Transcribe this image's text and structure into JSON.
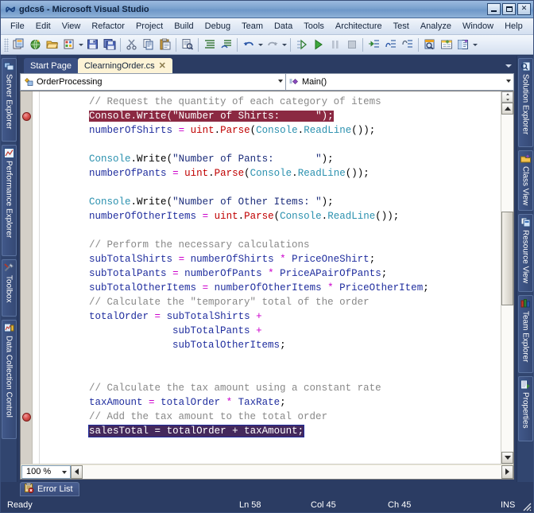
{
  "window": {
    "title": "gdcs6 - Microsoft Visual Studio",
    "app_icon": "visual-studio-icon",
    "minimize_label": "_",
    "maximize_label": "□",
    "close_label": "✕"
  },
  "menu": {
    "items": [
      {
        "label": "File"
      },
      {
        "label": "Edit"
      },
      {
        "label": "View"
      },
      {
        "label": "Refactor"
      },
      {
        "label": "Project"
      },
      {
        "label": "Build"
      },
      {
        "label": "Debug"
      },
      {
        "label": "Team"
      },
      {
        "label": "Data"
      },
      {
        "label": "Tools"
      },
      {
        "label": "Architecture"
      },
      {
        "label": "Test"
      },
      {
        "label": "Analyze"
      },
      {
        "label": "Window"
      },
      {
        "label": "Help"
      }
    ]
  },
  "toolbar": {
    "buttons": [
      {
        "name": "new-project-icon"
      },
      {
        "name": "add-new-website-icon"
      },
      {
        "name": "open-file-icon"
      },
      {
        "name": "add-new-item-icon"
      },
      {
        "name": "save-icon"
      },
      {
        "name": "save-all-icon"
      },
      {
        "name": "cut-icon"
      },
      {
        "name": "copy-icon"
      },
      {
        "name": "paste-icon"
      },
      {
        "name": "find-icon"
      },
      {
        "name": "comment-selection-icon"
      },
      {
        "name": "uncomment-selection-icon"
      },
      {
        "name": "undo-icon"
      },
      {
        "name": "redo-icon"
      },
      {
        "name": "start-debug-icon"
      },
      {
        "name": "continue-icon"
      },
      {
        "name": "break-all-icon"
      },
      {
        "name": "stop-debugging-icon"
      },
      {
        "name": "step-into-icon"
      },
      {
        "name": "step-over-icon"
      },
      {
        "name": "step-out-icon"
      },
      {
        "name": "solution-explorer-icon"
      },
      {
        "name": "properties-window-icon"
      },
      {
        "name": "object-browser-icon"
      },
      {
        "name": "toolbar-overflow-icon"
      }
    ]
  },
  "left_dock": {
    "tabs": [
      {
        "label": "Server Explorer",
        "icon": "server-explorer-icon"
      },
      {
        "label": "Performance Explorer",
        "icon": "performance-explorer-icon"
      },
      {
        "label": "Toolbox",
        "icon": "toolbox-icon"
      },
      {
        "label": "Data Collection Control",
        "icon": "data-collection-icon"
      }
    ]
  },
  "right_dock": {
    "tabs": [
      {
        "label": "Solution Explorer",
        "icon": "solution-explorer-icon"
      },
      {
        "label": "Class View",
        "icon": "class-view-icon"
      },
      {
        "label": "Resource View",
        "icon": "resource-view-icon"
      },
      {
        "label": "Team Explorer",
        "icon": "team-explorer-icon"
      },
      {
        "label": "Properties",
        "icon": "properties-icon"
      }
    ]
  },
  "document_tabs": {
    "tabs": [
      {
        "label": "Start Page",
        "active": false,
        "closable": false
      },
      {
        "label": "ClearningOrder.cs",
        "active": true,
        "closable": true,
        "close_label": "✕"
      }
    ],
    "overflow_menu": "tab-list-menu-icon"
  },
  "navigation_bar": {
    "class_combo": {
      "value": "OrderProcessing",
      "icon": "class-icon"
    },
    "member_combo": {
      "value": "Main()",
      "icon": "method-icon"
    }
  },
  "editor": {
    "zoom": "100 %",
    "breakpoints": [
      {
        "line_index": 1
      },
      {
        "line_index": 22
      }
    ],
    "lines": [
      {
        "indent": 8,
        "tokens": [
          {
            "t": "// Request the quantity of each category of items",
            "c": "cmt"
          }
        ]
      },
      {
        "indent": 8,
        "hl": "exec",
        "tokens": [
          {
            "t": "Console",
            "c": "typ"
          },
          {
            "t": ".",
            "c": "pun"
          },
          {
            "t": "Write",
            "c": "pun"
          },
          {
            "t": "(",
            "c": "pun"
          },
          {
            "t": "\"Number of Shirts:      \"",
            "c": "str"
          },
          {
            "t": ");",
            "c": "pun"
          }
        ]
      },
      {
        "indent": 8,
        "tokens": [
          {
            "t": "numberOfShirts",
            "c": "id"
          },
          {
            "t": " ",
            "c": "pun"
          },
          {
            "t": "=",
            "c": "op"
          },
          {
            "t": " ",
            "c": "pun"
          },
          {
            "t": "uint",
            "c": "red"
          },
          {
            "t": ".",
            "c": "pun"
          },
          {
            "t": "Parse",
            "c": "red"
          },
          {
            "t": "(",
            "c": "pun"
          },
          {
            "t": "Console",
            "c": "typ"
          },
          {
            "t": ".",
            "c": "pun"
          },
          {
            "t": "ReadLine",
            "c": "typ"
          },
          {
            "t": "());",
            "c": "pun"
          }
        ]
      },
      {
        "indent": 0,
        "tokens": []
      },
      {
        "indent": 8,
        "tokens": [
          {
            "t": "Console",
            "c": "typ"
          },
          {
            "t": ".",
            "c": "pun"
          },
          {
            "t": "Write",
            "c": "pun"
          },
          {
            "t": "(",
            "c": "pun"
          },
          {
            "t": "\"Number of Pants:       \"",
            "c": "str"
          },
          {
            "t": ");",
            "c": "pun"
          }
        ]
      },
      {
        "indent": 8,
        "tokens": [
          {
            "t": "numberOfPants",
            "c": "id"
          },
          {
            "t": " ",
            "c": "pun"
          },
          {
            "t": "=",
            "c": "op"
          },
          {
            "t": " ",
            "c": "pun"
          },
          {
            "t": "uint",
            "c": "red"
          },
          {
            "t": ".",
            "c": "pun"
          },
          {
            "t": "Parse",
            "c": "red"
          },
          {
            "t": "(",
            "c": "pun"
          },
          {
            "t": "Console",
            "c": "typ"
          },
          {
            "t": ".",
            "c": "pun"
          },
          {
            "t": "ReadLine",
            "c": "typ"
          },
          {
            "t": "());",
            "c": "pun"
          }
        ]
      },
      {
        "indent": 0,
        "tokens": []
      },
      {
        "indent": 8,
        "tokens": [
          {
            "t": "Console",
            "c": "typ"
          },
          {
            "t": ".",
            "c": "pun"
          },
          {
            "t": "Write",
            "c": "pun"
          },
          {
            "t": "(",
            "c": "pun"
          },
          {
            "t": "\"Number of Other Items: \"",
            "c": "str"
          },
          {
            "t": ");",
            "c": "pun"
          }
        ]
      },
      {
        "indent": 8,
        "tokens": [
          {
            "t": "numberOfOtherItems",
            "c": "id"
          },
          {
            "t": " ",
            "c": "pun"
          },
          {
            "t": "=",
            "c": "op"
          },
          {
            "t": " ",
            "c": "pun"
          },
          {
            "t": "uint",
            "c": "red"
          },
          {
            "t": ".",
            "c": "pun"
          },
          {
            "t": "Parse",
            "c": "red"
          },
          {
            "t": "(",
            "c": "pun"
          },
          {
            "t": "Console",
            "c": "typ"
          },
          {
            "t": ".",
            "c": "pun"
          },
          {
            "t": "ReadLine",
            "c": "typ"
          },
          {
            "t": "());",
            "c": "pun"
          }
        ]
      },
      {
        "indent": 0,
        "tokens": []
      },
      {
        "indent": 8,
        "tokens": [
          {
            "t": "// Perform the necessary calculations",
            "c": "cmt"
          }
        ]
      },
      {
        "indent": 8,
        "tokens": [
          {
            "t": "subTotalShirts",
            "c": "id"
          },
          {
            "t": " ",
            "c": "pun"
          },
          {
            "t": "=",
            "c": "op"
          },
          {
            "t": " ",
            "c": "pun"
          },
          {
            "t": "numberOfShirts",
            "c": "id"
          },
          {
            "t": " ",
            "c": "pun"
          },
          {
            "t": "*",
            "c": "op"
          },
          {
            "t": " ",
            "c": "pun"
          },
          {
            "t": "PriceOneShirt",
            "c": "id"
          },
          {
            "t": ";",
            "c": "pun"
          }
        ]
      },
      {
        "indent": 8,
        "tokens": [
          {
            "t": "subTotalPants",
            "c": "id"
          },
          {
            "t": " ",
            "c": "pun"
          },
          {
            "t": "=",
            "c": "op"
          },
          {
            "t": " ",
            "c": "pun"
          },
          {
            "t": "numberOfPants",
            "c": "id"
          },
          {
            "t": " ",
            "c": "pun"
          },
          {
            "t": "*",
            "c": "op"
          },
          {
            "t": " ",
            "c": "pun"
          },
          {
            "t": "PriceAPairOfPants",
            "c": "id"
          },
          {
            "t": ";",
            "c": "pun"
          }
        ]
      },
      {
        "indent": 8,
        "tokens": [
          {
            "t": "subTotalOtherItems",
            "c": "id"
          },
          {
            "t": " ",
            "c": "pun"
          },
          {
            "t": "=",
            "c": "op"
          },
          {
            "t": " ",
            "c": "pun"
          },
          {
            "t": "numberOfOtherItems",
            "c": "id"
          },
          {
            "t": " ",
            "c": "pun"
          },
          {
            "t": "*",
            "c": "op"
          },
          {
            "t": " ",
            "c": "pun"
          },
          {
            "t": "PriceOtherItem",
            "c": "id"
          },
          {
            "t": ";",
            "c": "pun"
          }
        ]
      },
      {
        "indent": 8,
        "tokens": [
          {
            "t": "// Calculate the \"temporary\" total of the order",
            "c": "cmt"
          }
        ]
      },
      {
        "indent": 8,
        "tokens": [
          {
            "t": "totalOrder",
            "c": "id"
          },
          {
            "t": " ",
            "c": "pun"
          },
          {
            "t": "=",
            "c": "op"
          },
          {
            "t": " ",
            "c": "pun"
          },
          {
            "t": "subTotalShirts",
            "c": "id"
          },
          {
            "t": " ",
            "c": "pun"
          },
          {
            "t": "+",
            "c": "op"
          }
        ]
      },
      {
        "indent": 22,
        "tokens": [
          {
            "t": "subTotalPants",
            "c": "id"
          },
          {
            "t": " ",
            "c": "pun"
          },
          {
            "t": "+",
            "c": "op"
          }
        ]
      },
      {
        "indent": 22,
        "tokens": [
          {
            "t": "subTotalOtherItems",
            "c": "id"
          },
          {
            "t": ";",
            "c": "pun"
          }
        ]
      },
      {
        "indent": 0,
        "tokens": []
      },
      {
        "indent": 0,
        "tokens": []
      },
      {
        "indent": 8,
        "tokens": [
          {
            "t": "// Calculate the tax amount using a constant rate",
            "c": "cmt"
          }
        ]
      },
      {
        "indent": 8,
        "tokens": [
          {
            "t": "taxAmount",
            "c": "id"
          },
          {
            "t": " ",
            "c": "pun"
          },
          {
            "t": "=",
            "c": "op"
          },
          {
            "t": " ",
            "c": "pun"
          },
          {
            "t": "totalOrder",
            "c": "id"
          },
          {
            "t": " ",
            "c": "pun"
          },
          {
            "t": "*",
            "c": "op"
          },
          {
            "t": " ",
            "c": "pun"
          },
          {
            "t": "TaxRate",
            "c": "id"
          },
          {
            "t": ";",
            "c": "pun"
          }
        ]
      },
      {
        "indent": 8,
        "tokens": [
          {
            "t": "// Add the tax amount to the total order",
            "c": "cmt"
          }
        ]
      },
      {
        "indent": 8,
        "hl": "sel",
        "tokens": [
          {
            "t": "salesTotal",
            "c": "id"
          },
          {
            "t": " ",
            "c": "pun"
          },
          {
            "t": "=",
            "c": "op"
          },
          {
            "t": " ",
            "c": "pun"
          },
          {
            "t": "totalOrder",
            "c": "id"
          },
          {
            "t": " ",
            "c": "pun"
          },
          {
            "t": "+",
            "c": "op"
          },
          {
            "t": " ",
            "c": "pun"
          },
          {
            "t": "taxAmount",
            "c": "id"
          },
          {
            "t": ";",
            "c": "pun"
          }
        ]
      }
    ]
  },
  "bottom_dock": {
    "error_list_tab": {
      "label": "Error List",
      "icon": "error-list-icon"
    }
  },
  "status_bar": {
    "state": "Ready",
    "line": "Ln 58",
    "column": "Col 45",
    "character": "Ch 45",
    "insert_mode": "INS"
  },
  "colors": {
    "title_bar": "#7ba2ce",
    "chrome_dark": "#2b3c63",
    "active_tab": "#fdf3d6",
    "exec_highlight": "#8b2942",
    "selection": "#44285c",
    "breakpoint": "#d9534f"
  }
}
